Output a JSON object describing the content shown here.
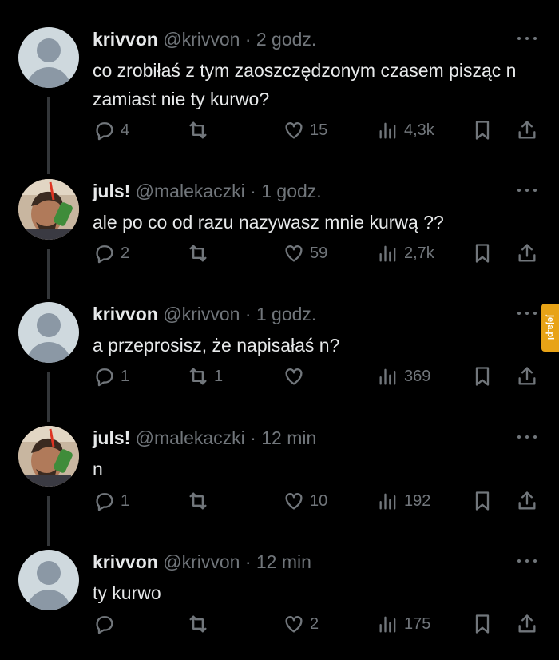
{
  "tweets": [
    {
      "name": "krivvon",
      "handle": "@krivvon",
      "time": "2 godz.",
      "text": "co zrobiłaś z tym zaoszczędzonym czasem pisząc n zamiast nie ty kurwo?",
      "replies": "4",
      "retweets": "",
      "likes": "15",
      "views": "4,3k",
      "avatar": "default"
    },
    {
      "name": "juls!",
      "handle": "@malekaczki",
      "time": "1 godz.",
      "text": "ale po co od razu nazywasz mnie kurwą ??",
      "replies": "2",
      "retweets": "",
      "likes": "59",
      "views": "2,7k",
      "avatar": "photo"
    },
    {
      "name": "krivvon",
      "handle": "@krivvon",
      "time": "1 godz.",
      "text": "a przeprosisz, że napisałaś n?",
      "replies": "1",
      "retweets": "1",
      "likes": "",
      "views": "369",
      "avatar": "default"
    },
    {
      "name": "juls!",
      "handle": "@malekaczki",
      "time": "12 min",
      "text": "n",
      "replies": "1",
      "retweets": "",
      "likes": "10",
      "views": "192",
      "avatar": "photo"
    },
    {
      "name": "krivvon",
      "handle": "@krivvon",
      "time": "12 min",
      "text": "ty kurwo",
      "replies": "",
      "retweets": "",
      "likes": "2",
      "views": "175",
      "avatar": "default"
    }
  ],
  "dot": "·",
  "watermark": "jeja.pl"
}
